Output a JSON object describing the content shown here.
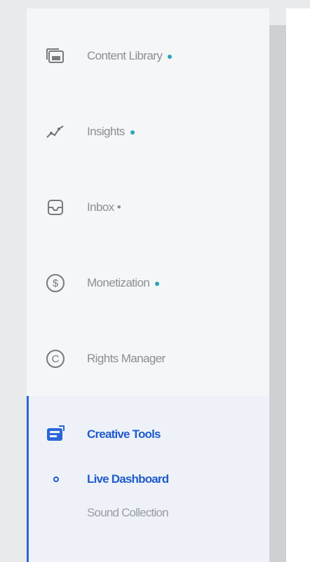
{
  "nav": {
    "items": [
      {
        "label": "Content Library",
        "dot": true,
        "icon": "content-library-icon"
      },
      {
        "label": "Insights",
        "dot": true,
        "icon": "insights-icon"
      },
      {
        "label": "Inbox",
        "dot": false,
        "suffix": "•",
        "icon": "inbox-icon"
      },
      {
        "label": "Monetization",
        "dot": true,
        "icon": "monetization-icon"
      },
      {
        "label": "Rights Manager",
        "dot": false,
        "icon": "rights-manager-icon"
      },
      {
        "label": "Creative Tools",
        "dot": false,
        "icon": "creative-tools-icon",
        "active": true
      }
    ],
    "sub_items": [
      {
        "label": "Live Dashboard",
        "active": true
      },
      {
        "label": "Sound Collection",
        "active": false
      }
    ]
  },
  "colors": {
    "accent": "#1f5bcc",
    "dot": "#2aa3b7",
    "muted": "#8b8f94"
  }
}
